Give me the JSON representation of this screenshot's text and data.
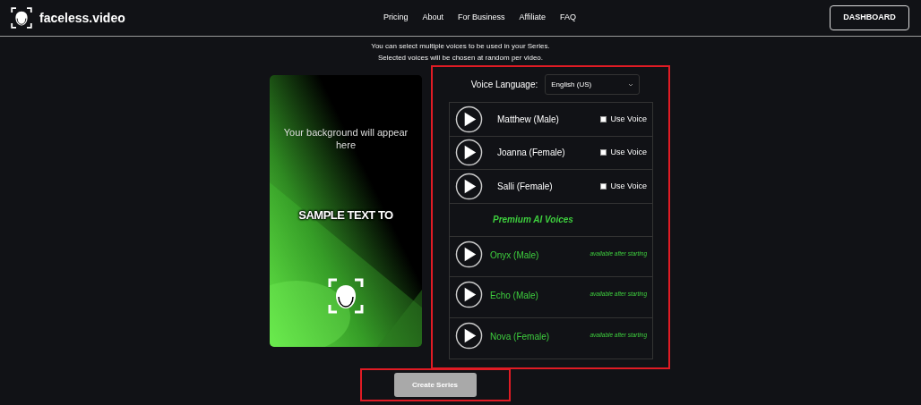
{
  "brand": {
    "name": "faceless.video"
  },
  "nav": [
    {
      "label": "Pricing"
    },
    {
      "label": "About"
    },
    {
      "label": "For Business"
    },
    {
      "label": "Affiliate"
    },
    {
      "label": "FAQ"
    }
  ],
  "dashboard_button": "DASHBOARD",
  "intro": [
    "You can select multiple voices to be used in your Series.",
    "Selected voices will be chosen at random per video."
  ],
  "preview": {
    "background_note": "Your background will appear here",
    "sample_text": "SAMPLE TEXT TO"
  },
  "voice_panel": {
    "highlighted": true,
    "language_label": "Voice Language:",
    "language": "English (US)",
    "voices": [
      {
        "kind": "standard",
        "name": "Matthew (Male)",
        "checked": false,
        "option": "Use Voice"
      },
      {
        "kind": "standard",
        "name": "Joanna (Female)",
        "checked": false,
        "option": "Use Voice"
      },
      {
        "kind": "standard",
        "name": "Salli (Female)",
        "checked": false,
        "option": "Use Voice"
      },
      {
        "kind": "heading",
        "name": "Premium AI Voices"
      },
      {
        "kind": "premium",
        "name": "Onyx (Male)",
        "note": "available after starting"
      },
      {
        "kind": "premium",
        "name": "Echo (Male)",
        "note": "available after starting"
      },
      {
        "kind": "premium",
        "name": "Nova (Female)",
        "note": "available after starting"
      }
    ]
  },
  "create_button": {
    "label": "Create Series",
    "highlighted": true
  }
}
